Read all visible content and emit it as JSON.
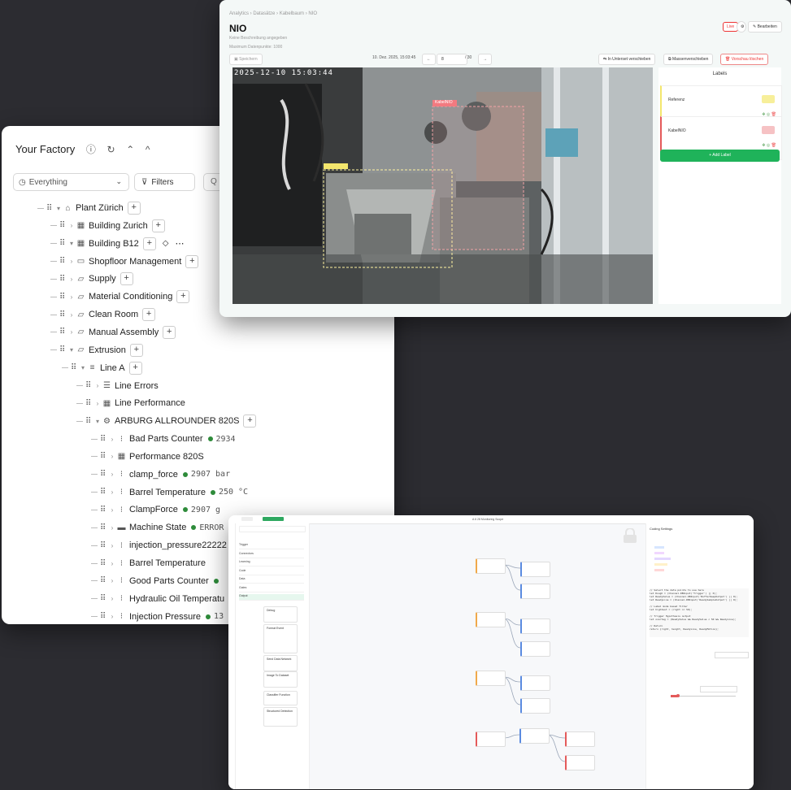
{
  "tree": {
    "title": "Your Factory",
    "scope_select": "Everything",
    "filters_label": "Filters",
    "search_placeholder": "Q",
    "rows": [
      {
        "label": "Plant Zürich",
        "icon": "plant-icon",
        "glyph": "⌂",
        "level": 0,
        "expanded": true,
        "plus": true
      },
      {
        "label": "Building Zurich",
        "icon": "building-icon",
        "glyph": "▦",
        "level": 1,
        "expanded": false,
        "plus": true
      },
      {
        "label": "Building B12",
        "icon": "building-icon",
        "glyph": "▦",
        "level": 1,
        "expanded": true,
        "plus": true,
        "extra": true
      },
      {
        "label": "Shopfloor Management",
        "icon": "folder-icon",
        "glyph": "▭",
        "level": 2,
        "plus": true
      },
      {
        "label": "Supply",
        "icon": "area-icon",
        "glyph": "▱",
        "level": 2,
        "plus": true
      },
      {
        "label": "Material Conditioning",
        "icon": "area-icon",
        "glyph": "▱",
        "level": 2,
        "plus": true
      },
      {
        "label": "Clean Room",
        "icon": "area-icon",
        "glyph": "▱",
        "level": 2,
        "plus": true
      },
      {
        "label": "Manual Assembly",
        "icon": "area-icon",
        "glyph": "▱",
        "level": 2,
        "plus": true
      },
      {
        "label": "Extrusion",
        "icon": "area-icon",
        "glyph": "▱",
        "level": 2,
        "expanded": true,
        "plus": true
      },
      {
        "label": "Line A",
        "icon": "line-icon",
        "glyph": "≡",
        "level": 3,
        "expanded": true,
        "plus": true
      },
      {
        "label": "Line Errors",
        "icon": "list-icon",
        "glyph": "☰",
        "level": 4
      },
      {
        "label": "Line Performance",
        "icon": "dashboard-icon",
        "glyph": "▦",
        "level": 4
      },
      {
        "label": "ARBURG ALLROUNDER 820S",
        "icon": "machine-icon",
        "glyph": "⚙",
        "level": 4,
        "expanded": true,
        "plus": true
      },
      {
        "label": "Bad Parts Counter",
        "icon": "datapoint-icon",
        "glyph": "⁝",
        "level": 5,
        "value": "2934"
      },
      {
        "label": "Performance 820S",
        "icon": "dashboard-icon",
        "glyph": "▦",
        "level": 5
      },
      {
        "label": "clamp_force",
        "icon": "datapoint-icon",
        "glyph": "⁝",
        "level": 5,
        "value": "2907 bar"
      },
      {
        "label": "Barrel Temperature",
        "icon": "datapoint-icon",
        "glyph": "⁝",
        "level": 5,
        "value": "250 °C"
      },
      {
        "label": "ClampForce",
        "icon": "datapoint-icon",
        "glyph": "⁝",
        "level": 5,
        "value": "2907 g"
      },
      {
        "label": "Machine State",
        "icon": "state-icon",
        "glyph": "▬",
        "level": 5,
        "value": "ERROR"
      },
      {
        "label": "injection_pressure22222",
        "icon": "datapoint-icon",
        "glyph": "⁝",
        "level": 5
      },
      {
        "label": "Barrel Temperature",
        "icon": "datapoint-icon",
        "glyph": "⁝",
        "level": 5
      },
      {
        "label": "Good Parts Counter",
        "icon": "datapoint-icon",
        "glyph": "⁝",
        "level": 5,
        "dot_only": true
      },
      {
        "label": "Hydraulic Oil Temperatu",
        "icon": "datapoint-icon",
        "glyph": "⁝",
        "level": 5
      },
      {
        "label": "Injection Pressure",
        "icon": "datapoint-icon",
        "glyph": "⁝",
        "level": 5,
        "value": "13"
      }
    ]
  },
  "nio": {
    "breadcrumb": "Analytics › Datasätze › Kabelbaum › NIO",
    "title": "NIO",
    "description": "Keine Beschreibung angegeben",
    "max_label": "Maximum Datenpunkte: 1000",
    "save_label": "Speichern",
    "live_label": "Live",
    "edit_label": "Bearbeiten",
    "datetime": "10. Dez. 2025, 15:03:45",
    "page_current": "8",
    "page_total": "/ 30",
    "move_subset_label": "In Unterset verschieben",
    "mass_move_label": "Massenverschieben",
    "delete_label": "Vorschau löschen",
    "timestamp_overlay": "2025-12-10 15:03:44",
    "labels_title": "Labels",
    "labels": [
      {
        "name": "Referenz",
        "color": "#f3e66d"
      },
      {
        "name": "KabelNIO",
        "color": "#f2a3a6"
      }
    ],
    "add_label": "+ Add Label",
    "box_tag": "KabelNIO"
  },
  "flow": {
    "topbar_title": "A 6 28 Monitoring Scope",
    "sidebar_items": [
      "Trigger",
      "Connectors",
      "Learning",
      "Code",
      "Data",
      "Gates",
      "Output"
    ],
    "cards": [
      "Debug",
      "Format Event",
      "Send Data Network",
      "Image To Dataset",
      "Classifier Function",
      "Structured Detection"
    ],
    "right_title": "Coding Settings",
    "code_lines": [
      "// Select the data points to use here",
      "let Dough = (Channel.DBInput('Trigger') || 0);",
      "let ReadyValue = (Channel.DBInput('BufferDeepOutput') || 0);",
      "let ReadyLine = (Channel.DBInput('ReadySampleOutput') || 0);",
      "",
      "// Label mode based filter",
      "let hightest = (right >= 50);",
      "",
      "// Trigger Hypothesis output",
      "let overtag = (ReadyValue && ReadyValue < 50 && ReadyLine);",
      "",
      "// Return",
      "return {right, height, ReadyLine, ReadyMotion};"
    ]
  },
  "colors": {
    "accent_green": "#1fb35a",
    "error_red": "#e33333",
    "status_dot": "#2e8b3a"
  }
}
